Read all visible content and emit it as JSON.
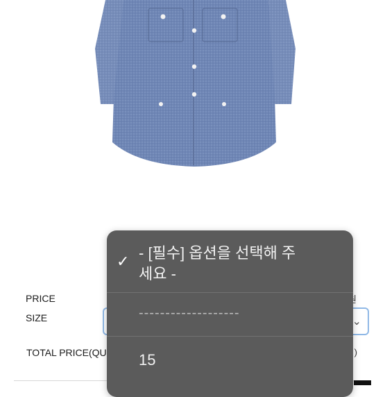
{
  "product": {
    "image_alt": "blue chambray shirt"
  },
  "details": {
    "price_label": "PRICE",
    "price_value_partial": "원",
    "size_label": "SIZE",
    "total_price_label": "TOTAL PRICE(QU",
    "total_price_value_partial": ")"
  },
  "size_dropdown": {
    "options": [
      {
        "label": "- [필수] 옵션을 선택해 주세요 -",
        "selected": true
      },
      {
        "label": "-------------------",
        "selected": false
      },
      {
        "label": "15",
        "selected": false
      }
    ],
    "check_icon": "✓",
    "chevron_icon": "⌄"
  },
  "colors": {
    "dropdown_bg": "#5b5b5b",
    "select_border": "#8fb8e6",
    "shirt_blue": "#6f86b5"
  }
}
